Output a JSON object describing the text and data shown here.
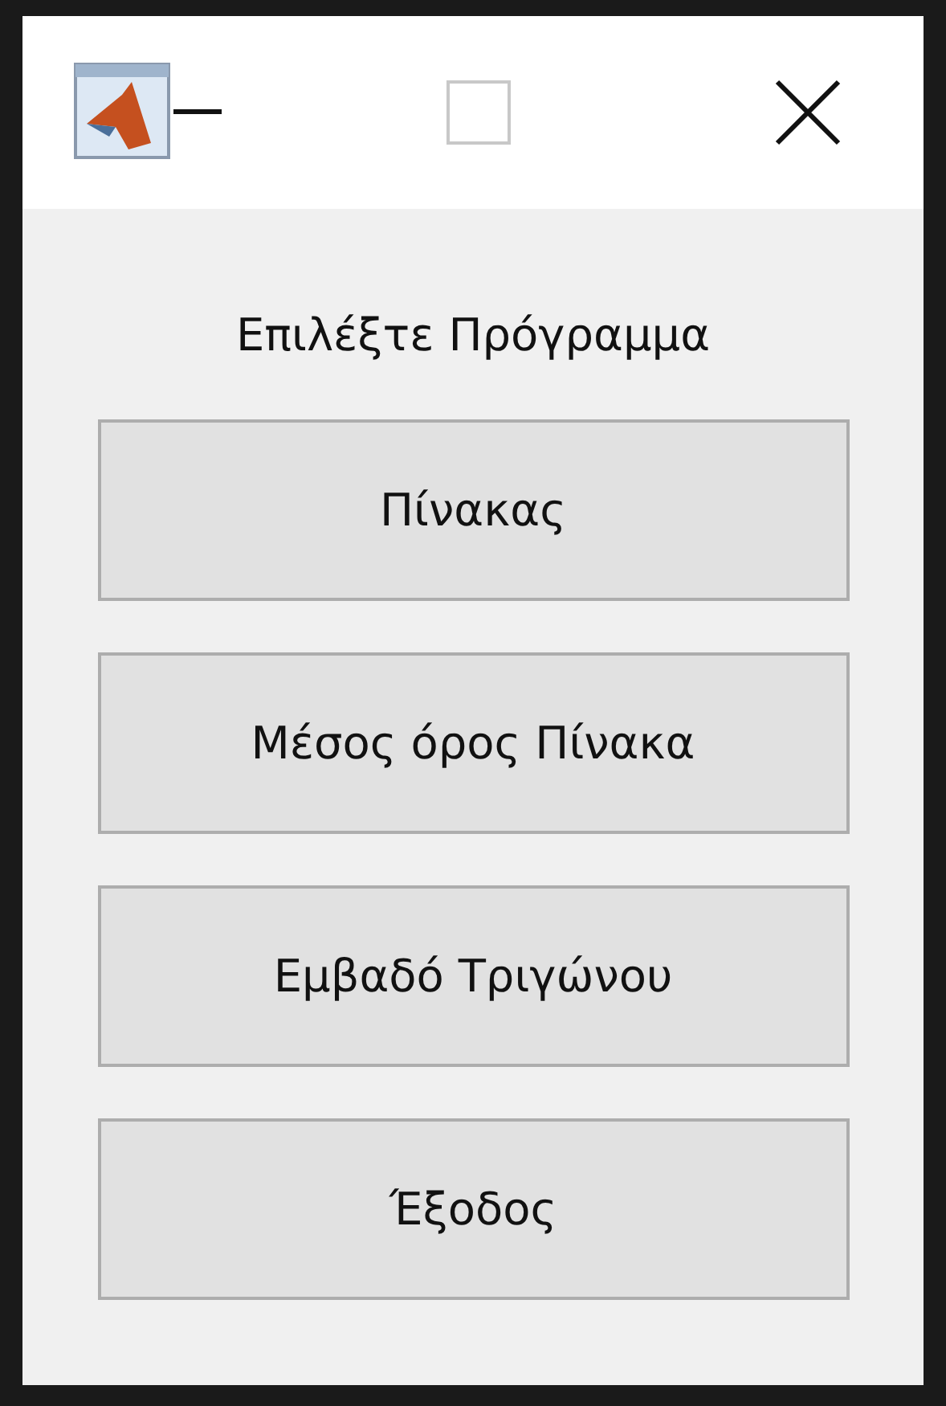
{
  "prompt": "Επιλέξτε Πρόγραμμα",
  "buttons": [
    {
      "label": "Πίνακας"
    },
    {
      "label": "Μέσος όρος Πίνακα"
    },
    {
      "label": "Εμβαδό Τριγώνου"
    },
    {
      "label": "Έξοδος"
    }
  ]
}
